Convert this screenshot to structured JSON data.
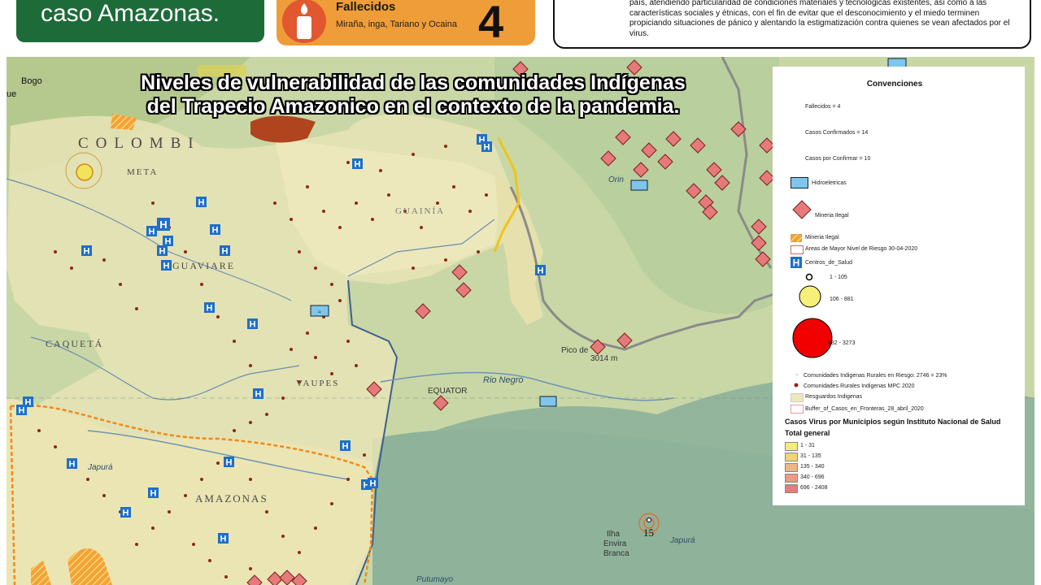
{
  "header": {
    "title": "caso Amazonas.",
    "stat_label": "Fallecidos",
    "stat_sub": "Miraña, inga, Tariano y Ocaina",
    "stat_value": "4",
    "note": "país, atendiendo particularidad de condiciones materiales y tecnológicas existentes, así como a las características sociales y étnicas, con el fin de evitar que el desconocimiento y el miedo terminen propiciando situaciones de pánico y alentando la estigmatización contra quienes se vean afectados por el virus."
  },
  "map": {
    "title_line1": "Niveles de vulnerabilidad de las comunidades Indígenas",
    "title_line2": "del Trapecio Amazonico en el contexto de la pandemia.",
    "labels": {
      "colombia": "COLOMBI",
      "meta": "META",
      "guaviare": "GUAVIARE",
      "caqueta": "CAQUETÁ",
      "vaupes": "VAUPES",
      "guainia": "GUAINÍA",
      "amazonas": "AMAZONAS",
      "bogota": "Bogo",
      "equator": "EQUATOR",
      "rio_negro": "Rio Negro",
      "pico": "Pico de",
      "pico_alt": "3014 m",
      "ilha1": "Ilha",
      "ilha2": "Envira",
      "ilha3": "Branca",
      "japura": "Japurá",
      "japura2": "Japurá",
      "putumayo": "Putumayo",
      "orinoco": "Orin",
      "marker_15": "15",
      "edge_que": "ue"
    }
  },
  "legend": {
    "title": "Convenciones",
    "fallecidos": "Fallecidos = 4",
    "confirmados": "Casos Confirmados = 14",
    "por_confirmar": "Casos por Confirmar = 10",
    "hidro": "Hidroeletricas",
    "mineria1": "Mineria Ilegal",
    "mineria2": "Mineria Ilegal",
    "areas": "Areas de Mayor Nivel de Riesgo 30-04-2020",
    "centros": "Centros_de_Salud",
    "c1": "1 - 105",
    "c2": "106 - 881",
    "c3": "882 - 3273",
    "riesgo": "Comunidades Indigenas Rurales en Riesgo: 2746 = 23%",
    "mpc": "Comunidades Rurales Indigenas MPC 2020",
    "resguardos": "Resguardos Indigenas",
    "buffer": "Buffer_of_Casos_en_Fronteras_28_abril_2020",
    "casos_head": "Casos Virus por Municipios según Instituto Nacional de Salud",
    "total_head": "Total general",
    "classes": [
      {
        "label": "1 - 31",
        "color": "#f4ee7a"
      },
      {
        "label": "31 - 135",
        "color": "#f2d27a"
      },
      {
        "label": "135 - 340",
        "color": "#eeb684"
      },
      {
        "label": "340 - 696",
        "color": "#ec9a86"
      },
      {
        "label": "696 - 2408",
        "color": "#e67c7c"
      }
    ]
  }
}
